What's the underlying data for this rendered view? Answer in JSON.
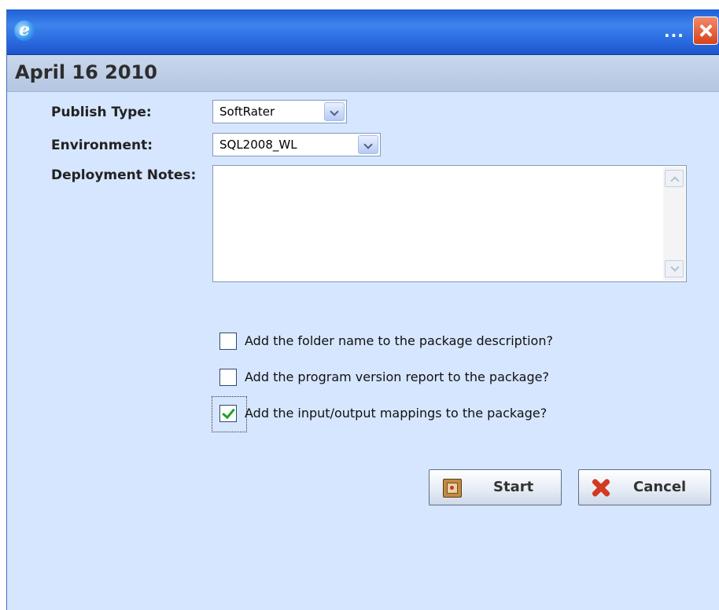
{
  "window": {
    "title_ellipsis": "...",
    "icons": {
      "app": "internet-explorer-icon",
      "close": "close-icon"
    }
  },
  "header": {
    "title": "April 16 2010"
  },
  "form": {
    "publish_type_label": "Publish Type:",
    "publish_type_value": "SoftRater",
    "environment_label": "Environment:",
    "environment_value": "SQL2008_WL",
    "notes_label": "Deployment Notes:",
    "notes_value": ""
  },
  "options": [
    {
      "label": "Add the folder name to the package description?",
      "checked": false
    },
    {
      "label": "Add the program version report to the package?",
      "checked": false
    },
    {
      "label": "Add the input/output mappings to the package?",
      "checked": true
    }
  ],
  "buttons": {
    "start_label": "Start",
    "cancel_label": "Cancel",
    "start_icon": "package-icon",
    "cancel_icon": "red-x-icon"
  },
  "colors": {
    "titlebar": "#2a6be0",
    "panel": "#d6e6ff",
    "header_band": "#b4c6e1",
    "check": "#1fa31f",
    "cancel_x": "#d23a22"
  }
}
